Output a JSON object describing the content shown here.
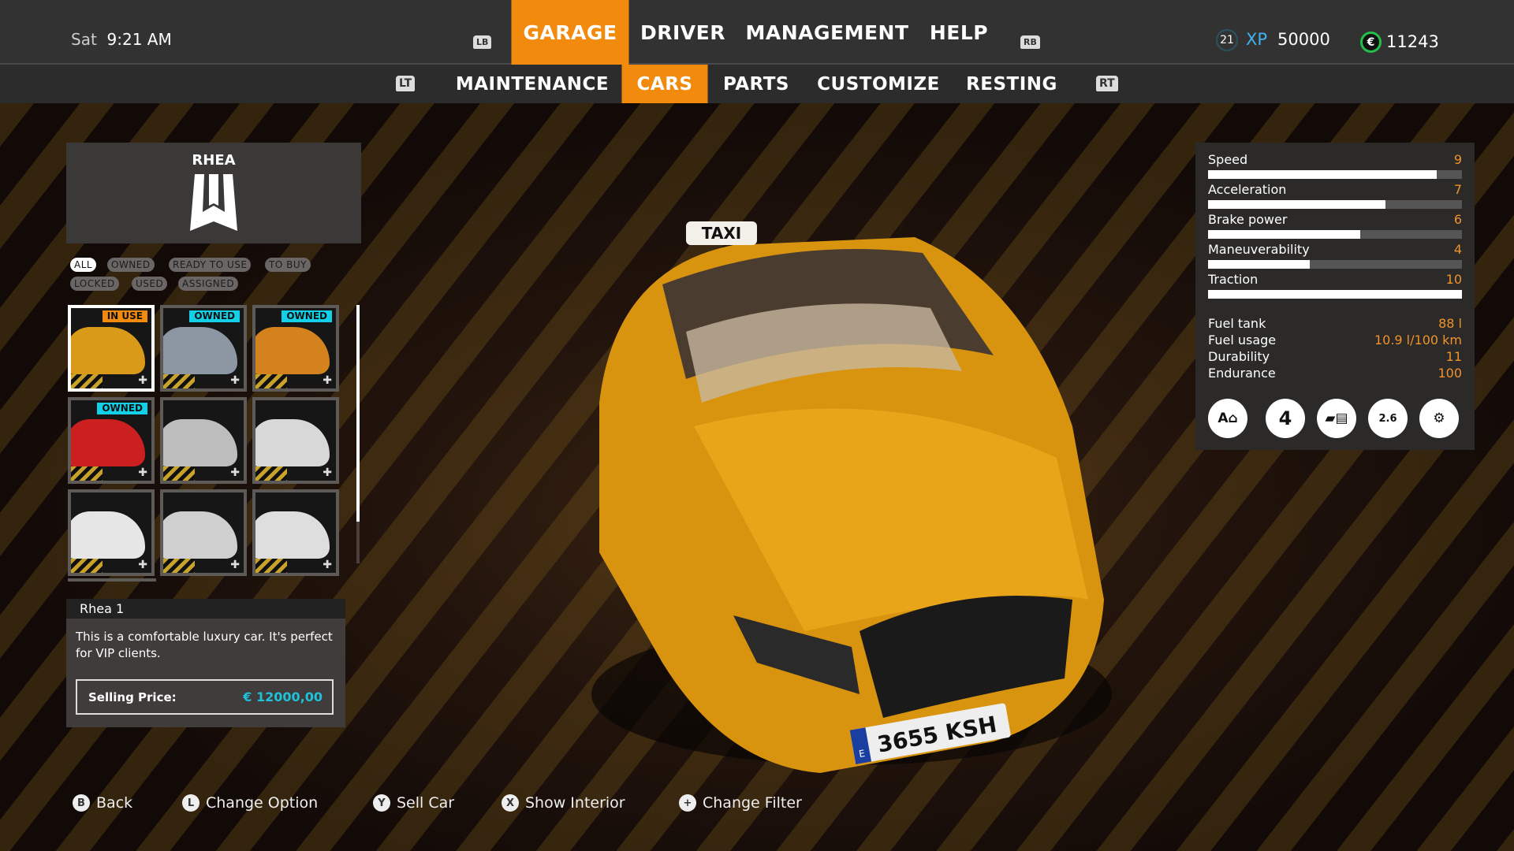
{
  "header": {
    "day": "Sat",
    "time": "9:21 AM",
    "lb": "LB",
    "rb": "RB",
    "tabs": [
      {
        "label": "GARAGE",
        "active": true
      },
      {
        "label": "DRIVER"
      },
      {
        "label": "MANAGEMENT"
      },
      {
        "label": "HELP"
      }
    ],
    "level": "21",
    "xp_label": "XP",
    "xp": "50000",
    "money": "11243",
    "currency_icon": "euro-icon",
    "accent": "#f28a0d"
  },
  "subnav": {
    "lt": "LT",
    "rt": "RT",
    "tabs": [
      {
        "label": "MAINTENANCE"
      },
      {
        "label": "CARS",
        "active": true
      },
      {
        "label": "PARTS"
      },
      {
        "label": "CUSTOMIZE"
      },
      {
        "label": "RESTING"
      }
    ]
  },
  "brand": {
    "name": "RHEA"
  },
  "filters": [
    "ALL",
    "OWNED",
    "READY TO USE",
    "TO BUY",
    "LOCKED",
    "USED",
    "ASSIGNED"
  ],
  "active_filter": "ALL",
  "cars": [
    {
      "badge": "IN USE",
      "badge_color": "#f28a0d",
      "color": "#d99a1a",
      "selected": true
    },
    {
      "badge": "OWNED",
      "badge_color": "#12d0e8",
      "color": "#8d97a3"
    },
    {
      "badge": "OWNED",
      "badge_color": "#12d0e8",
      "color": "#d4821e"
    },
    {
      "badge": "OWNED",
      "badge_color": "#12d0e8",
      "color": "#cc1f1f"
    },
    {
      "color": "#bdbdbd"
    },
    {
      "color": "#d8d8d8"
    },
    {
      "color": "#e6e6e6"
    },
    {
      "color": "#cfcfcf"
    },
    {
      "color": "#dedede"
    }
  ],
  "info": {
    "name": "Rhea  1",
    "description": "This is a comfortable luxury car. It's perfect for VIP clients.",
    "price_label": "Selling Price:",
    "price": "€ 12000,00"
  },
  "stats": {
    "bars": [
      {
        "label": "Speed",
        "value": "9",
        "fill": 0.9
      },
      {
        "label": "Acceleration",
        "value": "7",
        "fill": 0.7
      },
      {
        "label": "Brake power",
        "value": "6",
        "fill": 0.6
      },
      {
        "label": "Maneuverability",
        "value": "4",
        "fill": 0.4
      },
      {
        "label": "Traction",
        "value": "10",
        "fill": 1.0
      }
    ],
    "specs": [
      {
        "label": "Fuel tank",
        "value": "88 l"
      },
      {
        "label": "Fuel usage",
        "value": "10.9 l/100 km"
      },
      {
        "label": "Durability",
        "value": "11"
      },
      {
        "label": "Endurance",
        "value": "100"
      }
    ],
    "icons": [
      "automatic-transmission-icon",
      "seats-4-icon",
      "trunk-icon",
      "weight-icon",
      "engine-icon"
    ],
    "weight": "2.6",
    "seats": "4",
    "transmission": "A"
  },
  "car_view": {
    "roof_sign": "TAXI",
    "plate": "3655 KSH",
    "plate_country": "E"
  },
  "hints": [
    {
      "button": "B",
      "label": "Back"
    },
    {
      "button": "L",
      "label": "Change Option"
    },
    {
      "button": "Y",
      "label": "Sell Car"
    },
    {
      "button": "X",
      "label": "Show Interior"
    },
    {
      "button": "+",
      "label": "Change Filter"
    }
  ]
}
